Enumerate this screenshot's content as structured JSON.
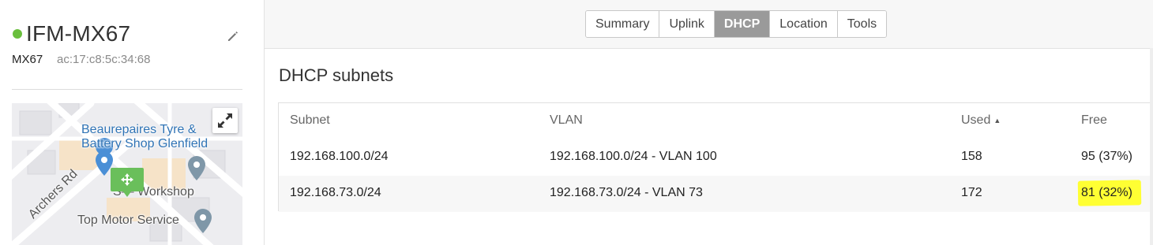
{
  "device": {
    "name": "IFM-MX67",
    "model": "MX67",
    "mac": "ac:17:c8:5c:34:68",
    "status_color": "#6abf3d",
    "edit_icon": "pencil-icon"
  },
  "map": {
    "poi_labels": [
      "Beaurepaires Tyre &",
      "Battery Shop Glenfield",
      "S— Workshop",
      "Top Motor Service"
    ],
    "road_label": "Archers Rd",
    "expand_icon": "expand-arrows-icon",
    "marker_icon": "move-arrows-icon"
  },
  "tabs": [
    {
      "label": "Summary",
      "active": false
    },
    {
      "label": "Uplink",
      "active": false
    },
    {
      "label": "DHCP",
      "active": true
    },
    {
      "label": "Location",
      "active": false
    },
    {
      "label": "Tools",
      "active": false
    }
  ],
  "dhcp": {
    "title": "DHCP subnets",
    "columns": {
      "subnet": "Subnet",
      "vlan": "VLAN",
      "used": "Used",
      "free": "Free"
    },
    "sort_indicator": "▲",
    "rows": [
      {
        "subnet": "192.168.100.0/24",
        "vlan": "192.168.100.0/24 - VLAN 100",
        "used": "158",
        "free": "95 (37%)"
      },
      {
        "subnet": "192.168.73.0/24",
        "vlan": "192.168.73.0/24 - VLAN 73",
        "used": "172",
        "free": "81 (32%)"
      }
    ],
    "highlight_color": "#ffff33"
  }
}
